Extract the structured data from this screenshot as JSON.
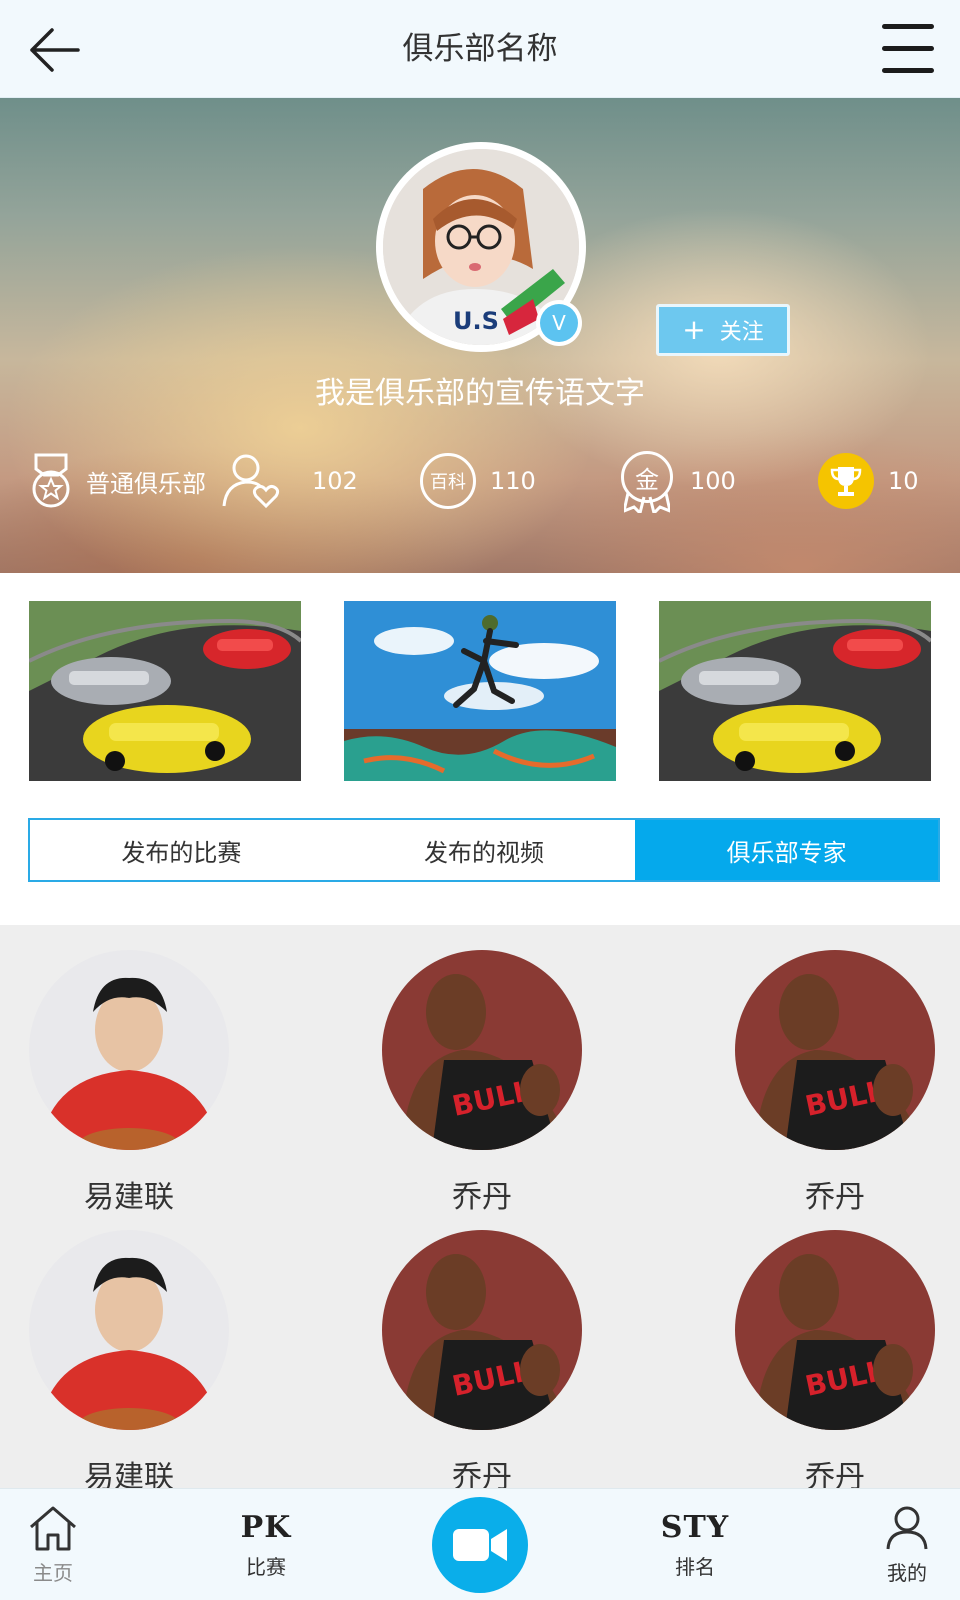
{
  "header": {
    "title": "俱乐部名称",
    "back_icon": "arrow-left-icon",
    "menu_icon": "hamburger-menu-icon"
  },
  "club": {
    "verified_label": "V",
    "follow_plus": "+",
    "follow_label": "关注",
    "slogan": "我是俱乐部的宣传语文字",
    "stats": {
      "level_label": "普通俱乐部",
      "fans": "102",
      "wiki_badge": "百科",
      "wiki": "110",
      "gold_badge": "金",
      "gold": "100",
      "trophies": "10"
    }
  },
  "tabs": [
    {
      "label": "发布的比赛",
      "active": false
    },
    {
      "label": "发布的视频",
      "active": false
    },
    {
      "label": "俱乐部专家",
      "active": true
    }
  ],
  "experts": [
    {
      "name": "易建联"
    },
    {
      "name": "乔丹"
    },
    {
      "name": "乔丹"
    },
    {
      "name": "易建联"
    },
    {
      "name": "乔丹"
    },
    {
      "name": "乔丹"
    }
  ],
  "bottom_nav": {
    "home": "主页",
    "pk_logo": "PK",
    "pk_label": "比赛",
    "sty_logo": "STY",
    "sty_label": "排名",
    "me": "我的"
  },
  "colors": {
    "accent": "#05a9ec",
    "follow_button": "#6dc8ef",
    "verified": "#5cc3f0",
    "trophy": "#f5c400",
    "experts_bg": "#eeeeee",
    "nav_bg": "#f2f9fd"
  }
}
